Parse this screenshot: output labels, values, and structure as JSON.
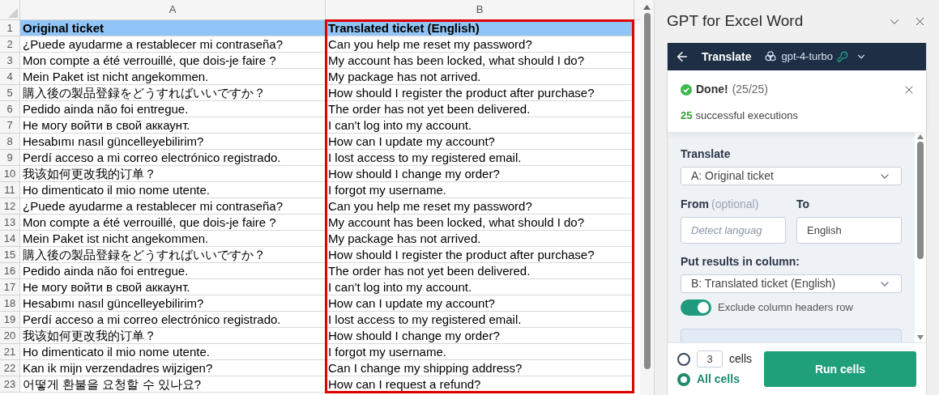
{
  "sheet": {
    "columns": [
      {
        "label": "A",
        "selected": false
      },
      {
        "label": "B",
        "selected": true
      }
    ],
    "rows": [
      {
        "number": "1",
        "kind": "header",
        "cells": [
          "Original ticket",
          "Translated ticket (English)"
        ]
      },
      {
        "number": "2",
        "kind": "data",
        "cells": [
          "¿Puede ayudarme a restablecer mi contraseña?",
          "Can you help me reset my password?"
        ]
      },
      {
        "number": "3",
        "kind": "data",
        "cells": [
          "Mon compte a été verrouillé, que dois-je faire ?",
          "My account has been locked, what should I do?"
        ]
      },
      {
        "number": "4",
        "kind": "data",
        "cells": [
          "Mein Paket ist nicht angekommen.",
          "My package has not arrived."
        ]
      },
      {
        "number": "5",
        "kind": "data",
        "cells": [
          "購入後の製品登録をどうすればいいですか？",
          "How should I register the product after purchase?"
        ]
      },
      {
        "number": "6",
        "kind": "data",
        "cells": [
          "Pedido ainda não foi entregue.",
          "The order has not yet been delivered."
        ]
      },
      {
        "number": "7",
        "kind": "data",
        "cells": [
          "Не могу войти в свой аккаунт.",
          "I can't log into my account."
        ]
      },
      {
        "number": "8",
        "kind": "data",
        "cells": [
          "Hesabımı nasıl güncelleyebilirim?",
          "How can I update my account?"
        ]
      },
      {
        "number": "9",
        "kind": "data",
        "cells": [
          "Perdí acceso a mi correo electrónico registrado.",
          "I lost access to my registered email."
        ]
      },
      {
        "number": "10",
        "kind": "data",
        "cells": [
          "我该如何更改我的订单？",
          "How should I change my order?"
        ]
      },
      {
        "number": "11",
        "kind": "data",
        "cells": [
          "Ho dimenticato il mio nome utente.",
          "I forgot my username."
        ]
      },
      {
        "number": "12",
        "kind": "data",
        "cells": [
          "¿Puede ayudarme a restablecer mi contraseña?",
          "Can you help me reset my password?"
        ]
      },
      {
        "number": "13",
        "kind": "data",
        "cells": [
          "Mon compte a été verrouillé, que dois-je faire ?",
          "My account has been locked, what should I do?"
        ]
      },
      {
        "number": "14",
        "kind": "data",
        "cells": [
          "Mein Paket ist nicht angekommen.",
          "My package has not arrived."
        ]
      },
      {
        "number": "15",
        "kind": "data",
        "cells": [
          "購入後の製品登録をどうすればいいですか？",
          "How should I register the product after purchase?"
        ]
      },
      {
        "number": "16",
        "kind": "data",
        "cells": [
          "Pedido ainda não foi entregue.",
          "The order has not yet been delivered."
        ]
      },
      {
        "number": "17",
        "kind": "data",
        "cells": [
          "Не могу войти в свой аккаунт.",
          "I can't log into my account."
        ]
      },
      {
        "number": "18",
        "kind": "data",
        "cells": [
          "Hesabımı nasıl güncelleyebilirim?",
          "How can I update my account?"
        ]
      },
      {
        "number": "19",
        "kind": "data",
        "cells": [
          "Perdí acceso a mi correo electrónico registrado.",
          "I lost access to my registered email."
        ]
      },
      {
        "number": "20",
        "kind": "data",
        "cells": [
          "我该如何更改我的订单？",
          "How should I change my order?"
        ]
      },
      {
        "number": "21",
        "kind": "data",
        "cells": [
          "Ho dimenticato il mio nome utente.",
          "I forgot my username."
        ]
      },
      {
        "number": "22",
        "kind": "data",
        "cells": [
          "Kan ik mijn verzendadres wijzigen?",
          "Can I change my shipping address?"
        ]
      },
      {
        "number": "23",
        "kind": "data",
        "cells": [
          "어떻게 환불을 요청할 수 있나요?",
          "How can I request a refund?"
        ]
      }
    ]
  },
  "pane": {
    "title": "GPT for Excel Word",
    "header": {
      "title": "Translate",
      "model": "gpt-4-turbo"
    },
    "status": {
      "title": "Done!",
      "count": "(25/25)",
      "number": "25",
      "text": "successful executions"
    },
    "form": {
      "translate_label": "Translate",
      "translate_value": "A: Original ticket",
      "from_label": "From",
      "from_hint": "(optional)",
      "from_placeholder": "Detect languag",
      "to_label": "To",
      "to_value": "English",
      "result_label": "Put results in column:",
      "result_value": "B: Translated ticket (English)",
      "toggle": {
        "label": "Exclude column headers row",
        "on": true
      }
    },
    "footer": {
      "options": [
        {
          "kind": "count",
          "value": "3",
          "label": "cells",
          "selected": false
        },
        {
          "kind": "all",
          "label": "All cells",
          "selected": true
        }
      ],
      "run": "Run cells"
    }
  }
}
